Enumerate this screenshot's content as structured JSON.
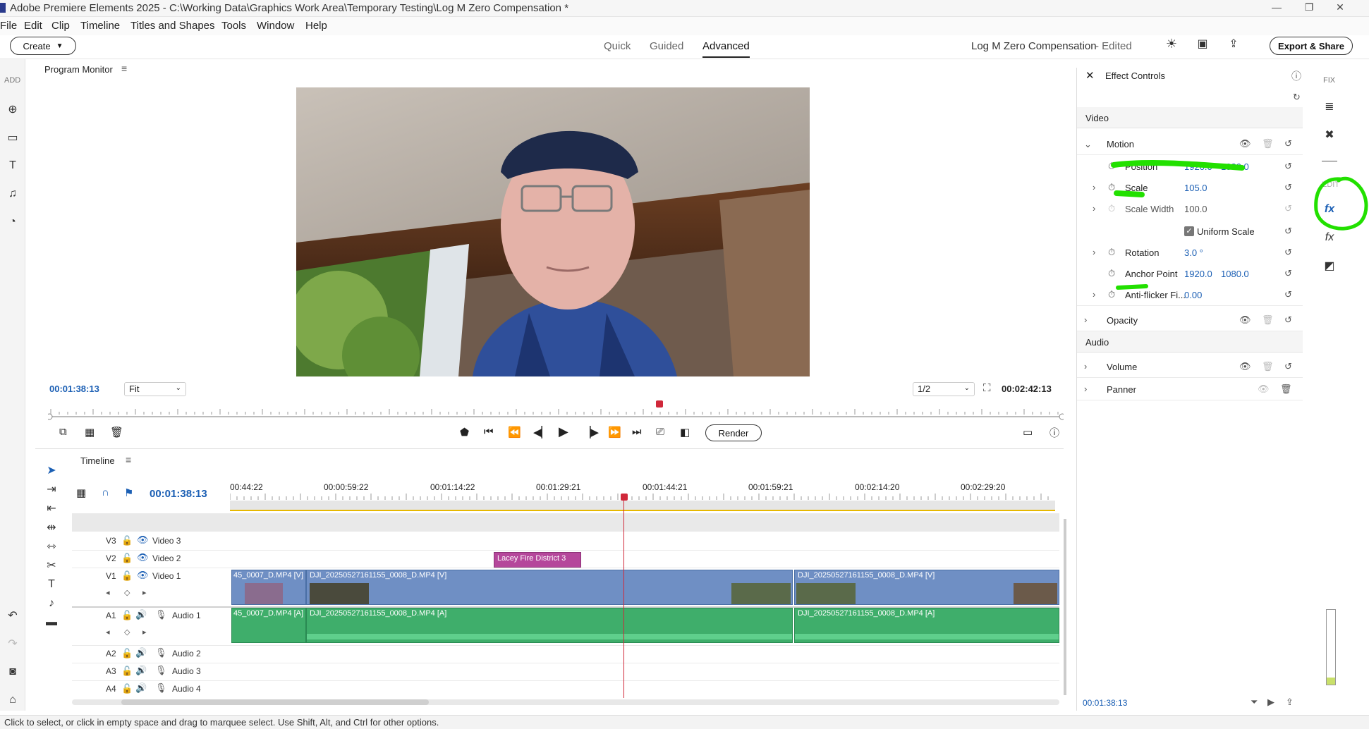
{
  "window": {
    "title": "Adobe Premiere Elements 2025 - C:\\Working Data\\Graphics Work Area\\Temporary Testing\\Log M Zero Compensation *",
    "min": "—",
    "max": "❐",
    "close": "✕"
  },
  "menu": [
    "File",
    "Edit",
    "Clip",
    "Timeline",
    "Titles and Shapes",
    "Tools",
    "Window",
    "Help"
  ],
  "toolbar": {
    "create_label": "Create",
    "modes": [
      "Quick",
      "Guided",
      "Advanced"
    ],
    "active_mode": "Advanced",
    "project_name": "Log M Zero Compensation",
    "project_status": "- Edited",
    "export_label": "Export & Share"
  },
  "left_strip": {
    "add_label": "ADD"
  },
  "monitor": {
    "title": "Program Monitor",
    "current_time": "00:01:38:13",
    "fit_value": "Fit",
    "quality_value": "1/2",
    "duration": "00:02:42:13",
    "render_label": "Render"
  },
  "timeline": {
    "title": "Timeline",
    "current_time": "00:01:38:13",
    "ruler": [
      "00:44:22",
      "00:00:59:22",
      "00:01:14:22",
      "00:01:29:21",
      "00:01:44:21",
      "00:01:59:21",
      "00:02:14:20",
      "00:02:29:20"
    ],
    "tracks": {
      "v3": {
        "id": "V3",
        "name": "Video 3"
      },
      "v2": {
        "id": "V2",
        "name": "Video 2"
      },
      "v1": {
        "id": "V1",
        "name": "Video 1"
      },
      "a1": {
        "id": "A1",
        "name": "Audio 1"
      },
      "a2": {
        "id": "A2",
        "name": "Audio 2"
      },
      "a3": {
        "id": "A3",
        "name": "Audio 3"
      },
      "a4": {
        "id": "A4",
        "name": "Audio 4"
      }
    },
    "clips": {
      "title_clip": "Lacey Fire District 3",
      "v1_a": "45_0007_D.MP4 [V]",
      "v1_b": "DJI_20250527161155_0008_D.MP4 [V]",
      "v1_c": "DJI_20250527161155_0008_D.MP4 [V]",
      "a1_a": "45_0007_D.MP4 [A]",
      "a1_b": "DJI_20250527161155_0008_D.MP4 [A]",
      "a1_c": "DJI_20250527161155_0008_D.MP4 [A]"
    }
  },
  "effects": {
    "title": "Effect Controls",
    "video_section": "Video",
    "motion": "Motion",
    "position": {
      "label": "Position",
      "x": "1920.0",
      "y": "1080.0"
    },
    "scale": {
      "label": "Scale",
      "value": "105.0"
    },
    "scale_width": {
      "label": "Scale Width",
      "value": "100.0"
    },
    "uniform_scale": "Uniform Scale",
    "rotation": {
      "label": "Rotation",
      "value": "3.0 °"
    },
    "anchor": {
      "label": "Anchor Point",
      "x": "1920.0",
      "y": "1080.0"
    },
    "antiflicker": {
      "label": "Anti-flicker Fi...",
      "value": "0.00"
    },
    "opacity": "Opacity",
    "audio_section": "Audio",
    "volume": "Volume",
    "panner": "Panner",
    "footer_time": "00:01:38:13"
  },
  "right_strip": {
    "fix_label": "FIX",
    "edit_label": "EDIT"
  },
  "status": "Click to select, or click in empty space and drag to marquee select. Use Shift, Alt, and Ctrl for other options.",
  "colors": {
    "accent_blue": "#1b5fb4",
    "playhead_red": "#d0283a",
    "highlight_green": "#22e000"
  }
}
